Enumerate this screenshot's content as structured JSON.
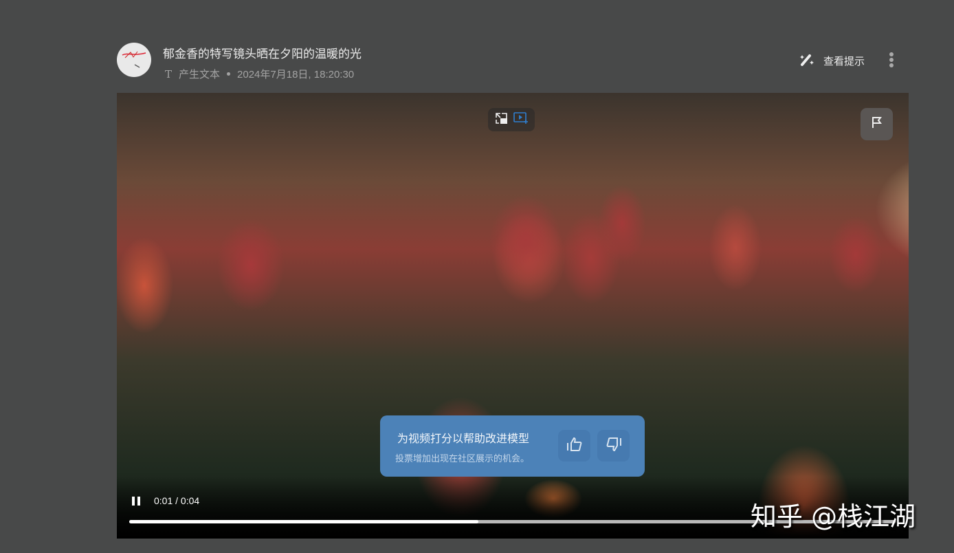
{
  "post": {
    "title": "郁金香的特写镜头晒在夕阳的温暖的光",
    "type_icon": "T",
    "type_label": "产生文本",
    "timestamp": "2024年7月18日, 18:20:30"
  },
  "header": {
    "hint_label": "查看提示"
  },
  "rating": {
    "heading": "为视频打分以帮助改进模型",
    "subtext": "投票增加出现在社区展示的机会。"
  },
  "player": {
    "time": "0:01 / 0:04",
    "progress_percent": 45.5
  },
  "watermark": "知乎 @栈江湖",
  "colors": {
    "background": "#484949",
    "rating_panel": "#4c82b8",
    "accent_icon": "#2f7fd0"
  }
}
